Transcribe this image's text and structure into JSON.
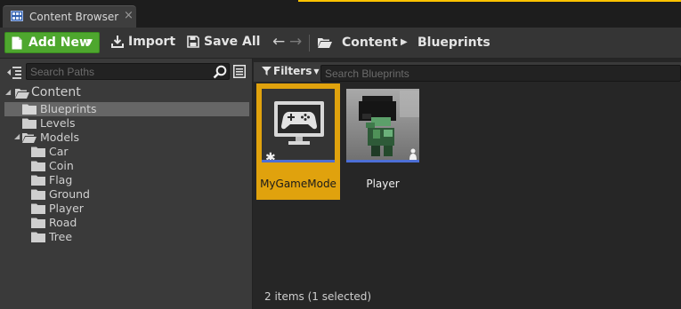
{
  "tab": {
    "title": "Content Browser",
    "close": "×"
  },
  "toolbar": {
    "add_new": "Add New",
    "import": "Import",
    "save_all": "Save All",
    "back": "←",
    "forward": "→",
    "breadcrumb": [
      "Content",
      "Blueprints"
    ]
  },
  "left": {
    "search_placeholder": "Search Paths",
    "tree": [
      {
        "label": "Content",
        "level": 0,
        "expanded": true
      },
      {
        "label": "Blueprints",
        "level": 1,
        "selected": true
      },
      {
        "label": "Levels",
        "level": 1
      },
      {
        "label": "Models",
        "level": 1,
        "expanded": true
      },
      {
        "label": "Car",
        "level": 2
      },
      {
        "label": "Coin",
        "level": 2
      },
      {
        "label": "Flag",
        "level": 2
      },
      {
        "label": "Ground",
        "level": 2
      },
      {
        "label": "Player",
        "level": 2
      },
      {
        "label": "Road",
        "level": 2
      },
      {
        "label": "Tree",
        "level": 2
      }
    ]
  },
  "right": {
    "filters_label": "Filters",
    "search_placeholder": "Search Blueprints",
    "assets": [
      {
        "name": "MyGameMode",
        "selected": true,
        "icon": "gamepad-icon"
      },
      {
        "name": "Player",
        "selected": false,
        "icon": "character-icon"
      }
    ],
    "status": "2 items (1 selected)"
  },
  "colors": {
    "accent": "#ffc300",
    "add_new": "#4ea72e",
    "selection": "#e0a20d",
    "asset_bar": "#4d6fd6"
  }
}
